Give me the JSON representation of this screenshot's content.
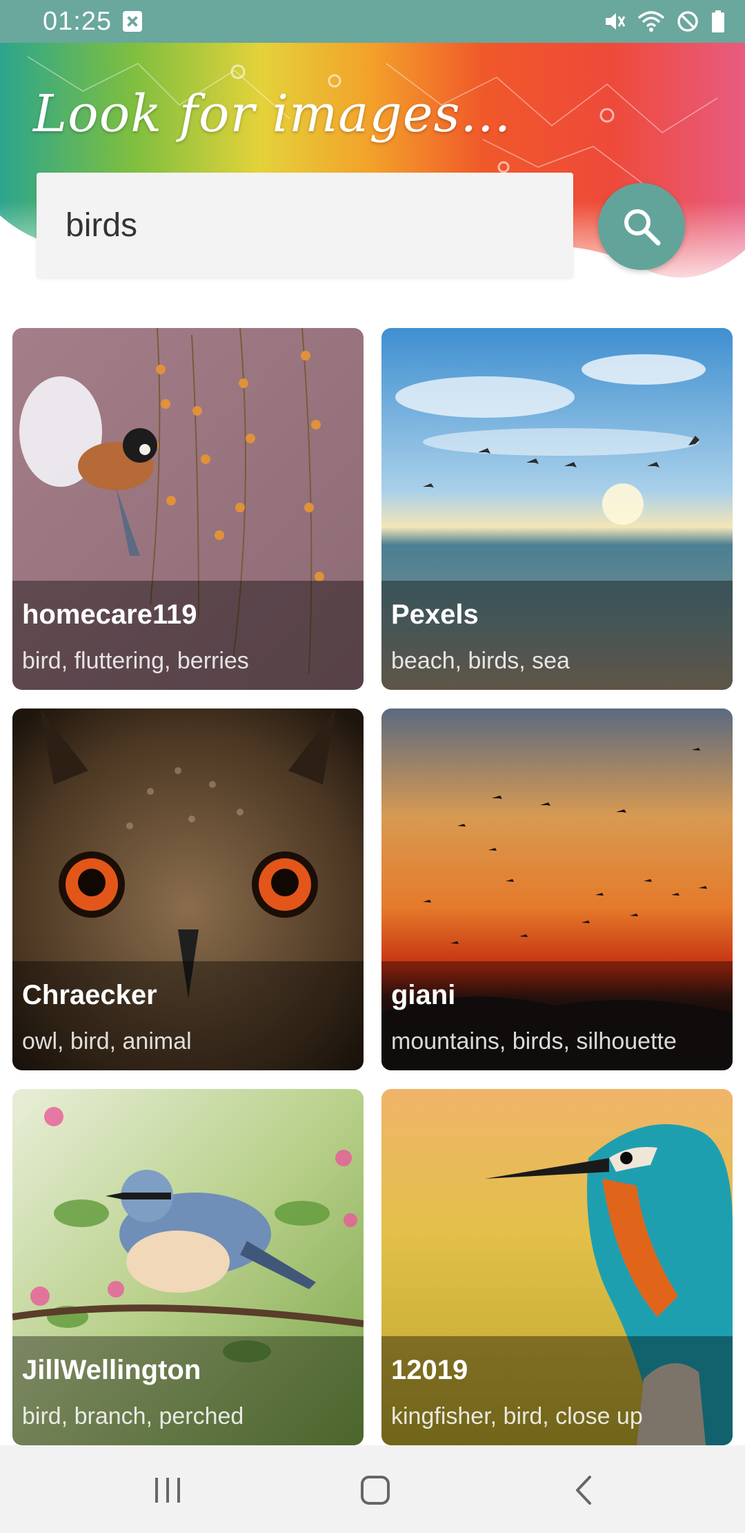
{
  "status_bar": {
    "time": "01:25"
  },
  "header": {
    "title": "Look for images...",
    "search_value": "birds",
    "search_icon": "search-icon"
  },
  "results": [
    {
      "user": "homecare119",
      "tags": "bird, fluttering, berries"
    },
    {
      "user": "Pexels",
      "tags": "beach, birds, sea"
    },
    {
      "user": "Chraecker",
      "tags": "owl, bird, animal"
    },
    {
      "user": "giani",
      "tags": "mountains, birds, silhouette"
    },
    {
      "user": "JillWellington",
      "tags": "bird, branch, perched"
    },
    {
      "user": "12019",
      "tags": "kingfisher, bird, close up"
    }
  ],
  "nav_bar": {
    "recents_icon": "recents-icon",
    "home_icon": "home-icon",
    "back_icon": "back-icon"
  },
  "colors": {
    "accent": "#63a49a",
    "status_bar": "#6aa79d"
  }
}
